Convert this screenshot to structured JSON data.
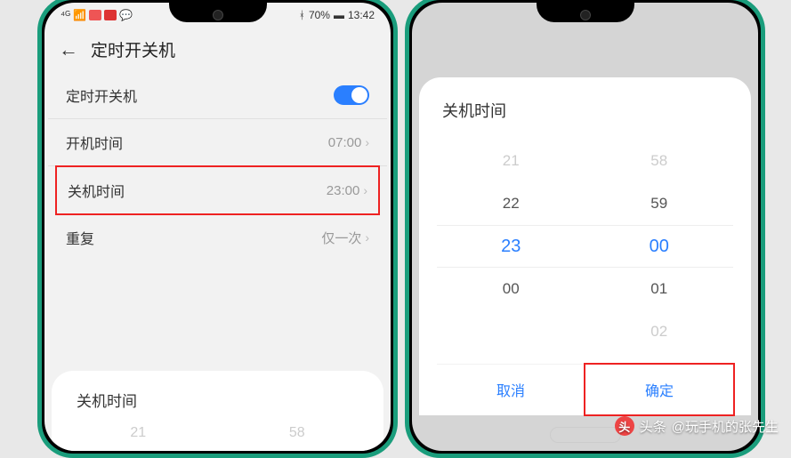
{
  "status_bar": {
    "battery_text": "70%",
    "time": "13:42"
  },
  "left_phone": {
    "page_title": "定时开关机",
    "rows": {
      "master_label": "定时开关机",
      "power_on_label": "开机时间",
      "power_on_value": "07:00",
      "power_off_label": "关机时间",
      "power_off_value": "23:00",
      "repeat_label": "重复",
      "repeat_value": "仅一次"
    },
    "bottom_card": {
      "title": "关机时间",
      "preview_hour": "21",
      "preview_min": "58"
    }
  },
  "right_phone": {
    "dialog_title": "关机时间",
    "picker": {
      "hours": [
        "21",
        "22",
        "23",
        "00",
        " "
      ],
      "minutes": [
        "58",
        "59",
        "00",
        "01",
        "02"
      ]
    },
    "cancel": "取消",
    "confirm": "确定"
  },
  "watermark": {
    "prefix": "头条",
    "text": "@玩手机的张先生"
  }
}
